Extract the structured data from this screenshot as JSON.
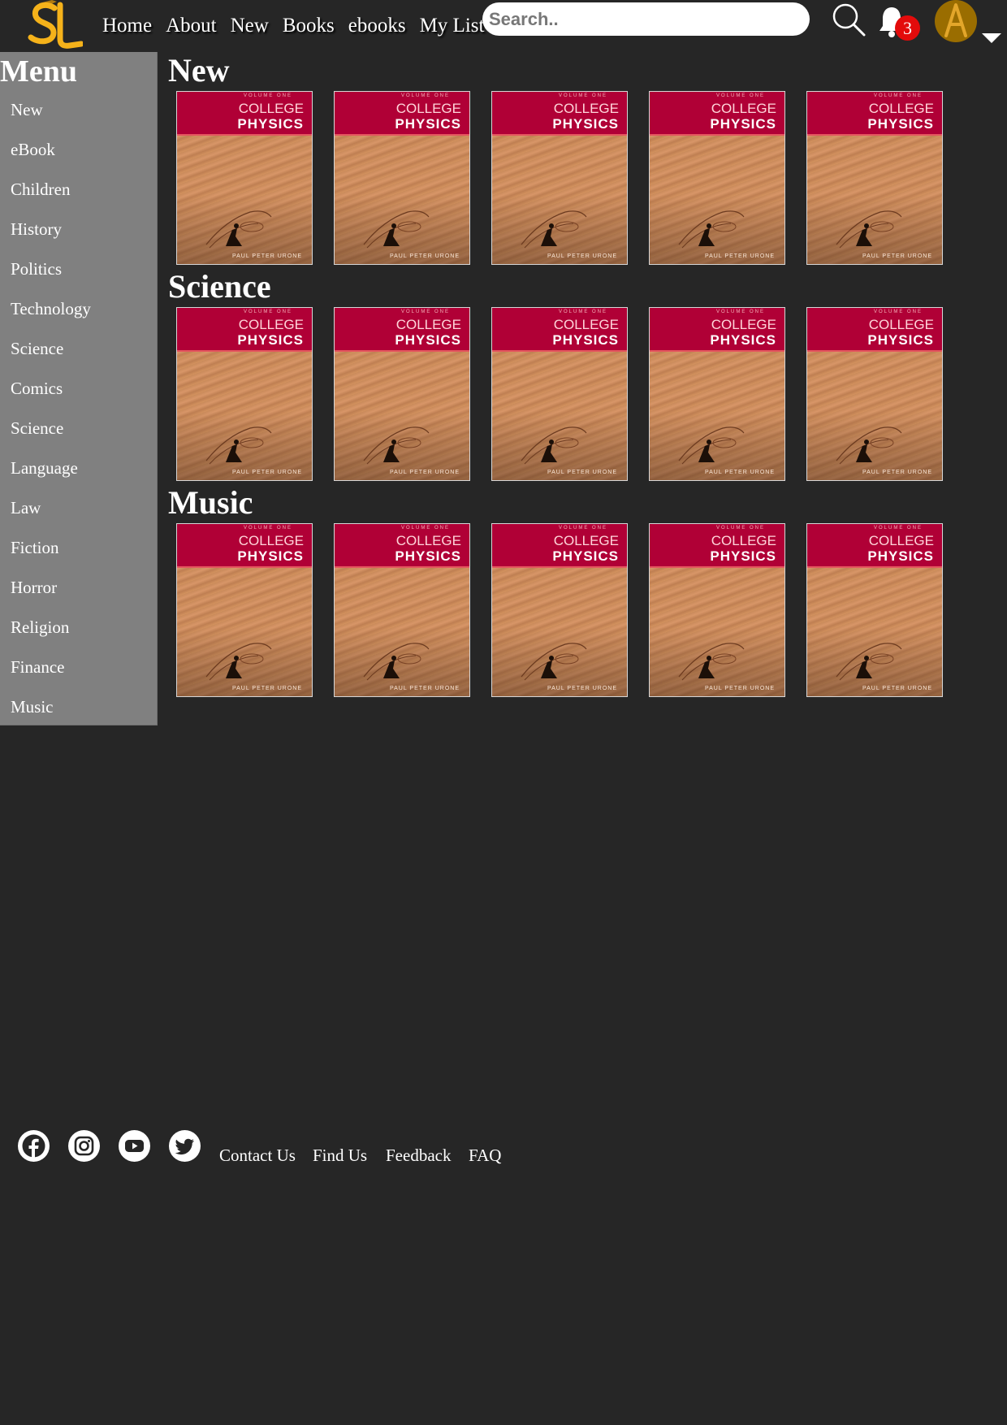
{
  "nav": {
    "links": [
      "Home",
      "About",
      "New",
      "Books",
      "ebooks",
      "My List"
    ],
    "search_placeholder": "Search..",
    "notification_count": "3",
    "accent_color": "#f5b21a"
  },
  "sidebar": {
    "title": "Menu",
    "items": [
      "New",
      "eBook",
      "Children",
      "History",
      "Politics",
      "Technology",
      "Science",
      "Comics",
      "Science",
      "Language",
      "Law",
      "Fiction",
      "Horror",
      "Religion",
      "Finance",
      "Music"
    ]
  },
  "sections": [
    {
      "title": "New",
      "books": [
        {
          "volume": "VOLUME ONE",
          "line1": "COLLEGE",
          "line2": "PHYSICS",
          "author": "PAUL PETER URONE"
        },
        {
          "volume": "VOLUME ONE",
          "line1": "COLLEGE",
          "line2": "PHYSICS",
          "author": "PAUL PETER URONE"
        },
        {
          "volume": "VOLUME ONE",
          "line1": "COLLEGE",
          "line2": "PHYSICS",
          "author": "PAUL PETER URONE"
        },
        {
          "volume": "VOLUME ONE",
          "line1": "COLLEGE",
          "line2": "PHYSICS",
          "author": "PAUL PETER URONE"
        },
        {
          "volume": "VOLUME ONE",
          "line1": "COLLEGE",
          "line2": "PHYSICS",
          "author": "PAUL PETER URONE"
        }
      ]
    },
    {
      "title": "Science",
      "books": [
        {
          "volume": "VOLUME ONE",
          "line1": "COLLEGE",
          "line2": "PHYSICS",
          "author": "PAUL PETER URONE"
        },
        {
          "volume": "VOLUME ONE",
          "line1": "COLLEGE",
          "line2": "PHYSICS",
          "author": "PAUL PETER URONE"
        },
        {
          "volume": "VOLUME ONE",
          "line1": "COLLEGE",
          "line2": "PHYSICS",
          "author": "PAUL PETER URONE"
        },
        {
          "volume": "VOLUME ONE",
          "line1": "COLLEGE",
          "line2": "PHYSICS",
          "author": "PAUL PETER URONE"
        },
        {
          "volume": "VOLUME ONE",
          "line1": "COLLEGE",
          "line2": "PHYSICS",
          "author": "PAUL PETER URONE"
        }
      ]
    },
    {
      "title": "Music",
      "books": [
        {
          "volume": "VOLUME ONE",
          "line1": "COLLEGE",
          "line2": "PHYSICS",
          "author": "PAUL PETER URONE"
        },
        {
          "volume": "VOLUME ONE",
          "line1": "COLLEGE",
          "line2": "PHYSICS",
          "author": "PAUL PETER URONE"
        },
        {
          "volume": "VOLUME ONE",
          "line1": "COLLEGE",
          "line2": "PHYSICS",
          "author": "PAUL PETER URONE"
        },
        {
          "volume": "VOLUME ONE",
          "line1": "COLLEGE",
          "line2": "PHYSICS",
          "author": "PAUL PETER URONE"
        },
        {
          "volume": "VOLUME ONE",
          "line1": "COLLEGE",
          "line2": "PHYSICS",
          "author": "PAUL PETER URONE"
        }
      ]
    }
  ],
  "footer": {
    "social_icons": [
      "facebook-icon",
      "instagram-icon",
      "youtube-icon",
      "twitter-icon"
    ],
    "links": [
      "Contact Us",
      "Find Us",
      "Feedback",
      "FAQ"
    ]
  }
}
